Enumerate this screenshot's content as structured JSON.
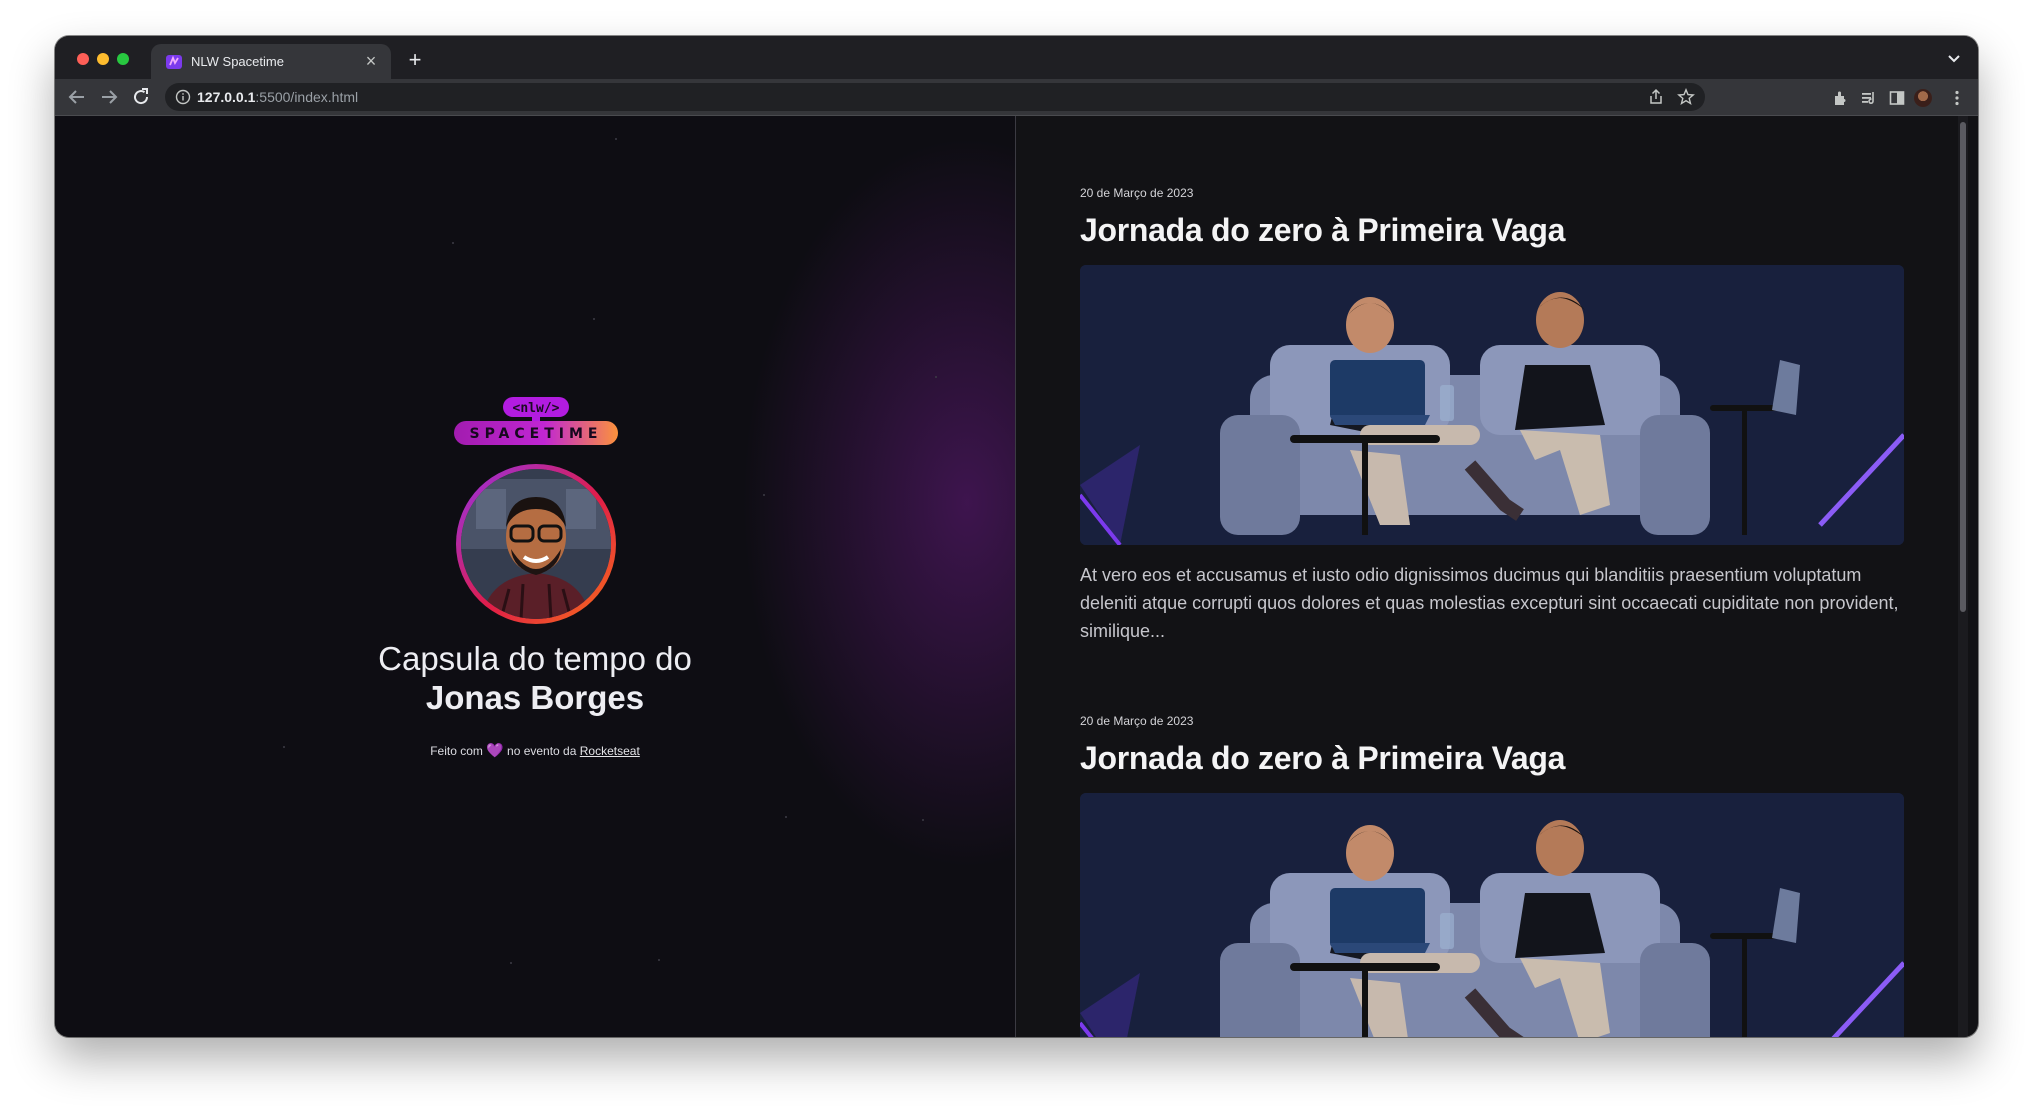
{
  "browser": {
    "tab_title": "NLW Spacetime",
    "url_host": "127.0.0.1",
    "url_rest": ":5500/index.html"
  },
  "profile": {
    "logo_tag": "<nlw/>",
    "logo_word": "SPACETIME",
    "headline_line1": "Capsula do tempo do",
    "headline_name": "Jonas Borges",
    "credit_before": "Feito com",
    "credit_heart": "💜",
    "credit_middle": "no evento da",
    "credit_link": "Rocketseat"
  },
  "posts": [
    {
      "date": "20 de Março de 2023",
      "title": "Jornada do zero à Primeira Vaga",
      "text": "At vero eos et accusamus et iusto odio dignissimos ducimus qui blanditiis praesentium voluptatum deleniti atque corrupti quos dolores et quas molestias excepturi sint occaecati cupiditate non provident, similique..."
    },
    {
      "date": "20 de Março de 2023",
      "title": "Jornada do zero à Primeira Vaga"
    }
  ],
  "colors": {
    "page_bg": "#121215",
    "accent_purple": "#9333ea",
    "accent_orange": "#f97316"
  }
}
